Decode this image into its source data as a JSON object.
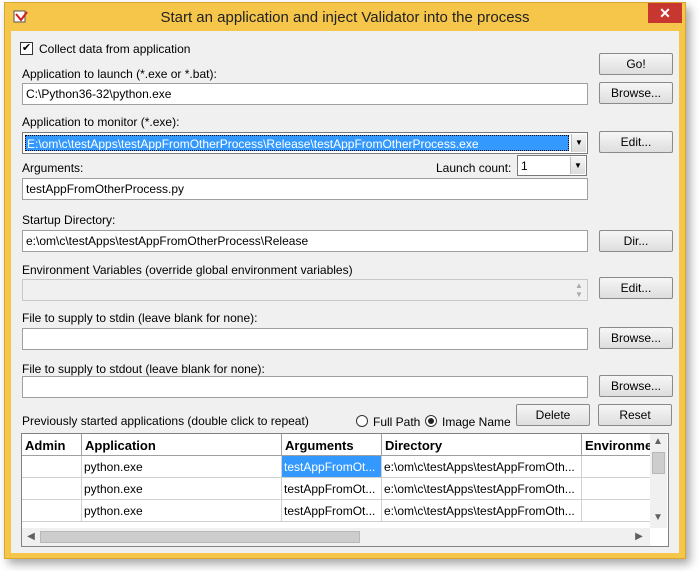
{
  "window": {
    "title": "Start an application and inject Validator into the process",
    "close_glyph": "✕"
  },
  "form": {
    "collect_label": "Collect data from application",
    "collect_checked": "✔",
    "launch_label": "Application to launch (*.exe or *.bat):",
    "launch_value": "C:\\Python36-32\\python.exe",
    "monitor_label": "Application to monitor (*.exe):",
    "monitor_value": "E:\\om\\c\\testApps\\testAppFromOtherProcess\\Release\\testAppFromOtherProcess.exe",
    "arguments_label": "Arguments:",
    "arguments_value": "testAppFromOtherProcess.py",
    "launch_count_label": "Launch count:",
    "launch_count_value": "1",
    "startup_label": "Startup Directory:",
    "startup_value": "e:\\om\\c\\testApps\\testAppFromOtherProcess\\Release",
    "env_label": "Environment Variables (override global environment variables)",
    "env_value": "",
    "stdin_label": "File to supply to stdin (leave blank for none):",
    "stdin_value": "",
    "stdout_label": "File to supply to stdout (leave blank for none):",
    "stdout_value": "",
    "previous_label": "Previously started applications (double click to repeat)",
    "radio_fullpath": "Full Path",
    "radio_imagename": "Image Name"
  },
  "buttons": {
    "go": "Go!",
    "browse_launch": "Browse...",
    "edit_monitor": "Edit...",
    "dir": "Dir...",
    "edit_env": "Edit...",
    "browse_stdin": "Browse...",
    "browse_stdout": "Browse...",
    "delete": "Delete",
    "reset": "Reset"
  },
  "grid": {
    "columns": [
      "Admin",
      "Application",
      "Arguments",
      "Directory",
      "Environment"
    ],
    "rows": [
      {
        "admin": "",
        "application": "python.exe",
        "arguments": "testAppFromOt...",
        "directory": "e:\\om\\c\\testApps\\testAppFromOth..."
      },
      {
        "admin": "",
        "application": "python.exe",
        "arguments": "testAppFromOt...",
        "directory": "e:\\om\\c\\testApps\\testAppFromOth..."
      },
      {
        "admin": "",
        "application": "python.exe",
        "arguments": "testAppFromOt...",
        "directory": "e:\\om\\c\\testApps\\testAppFromOth..."
      }
    ]
  },
  "icons": {
    "app": "validator-app-icon",
    "dropdown": "chevron-down-icon",
    "scroll_up": "▲",
    "scroll_down": "▼",
    "scroll_left": "◀",
    "scroll_right": "▶",
    "combo_arrow": "▼"
  },
  "colors": {
    "frame": "#f6c64b",
    "selection": "#3399ff",
    "close": "#c7372f"
  }
}
